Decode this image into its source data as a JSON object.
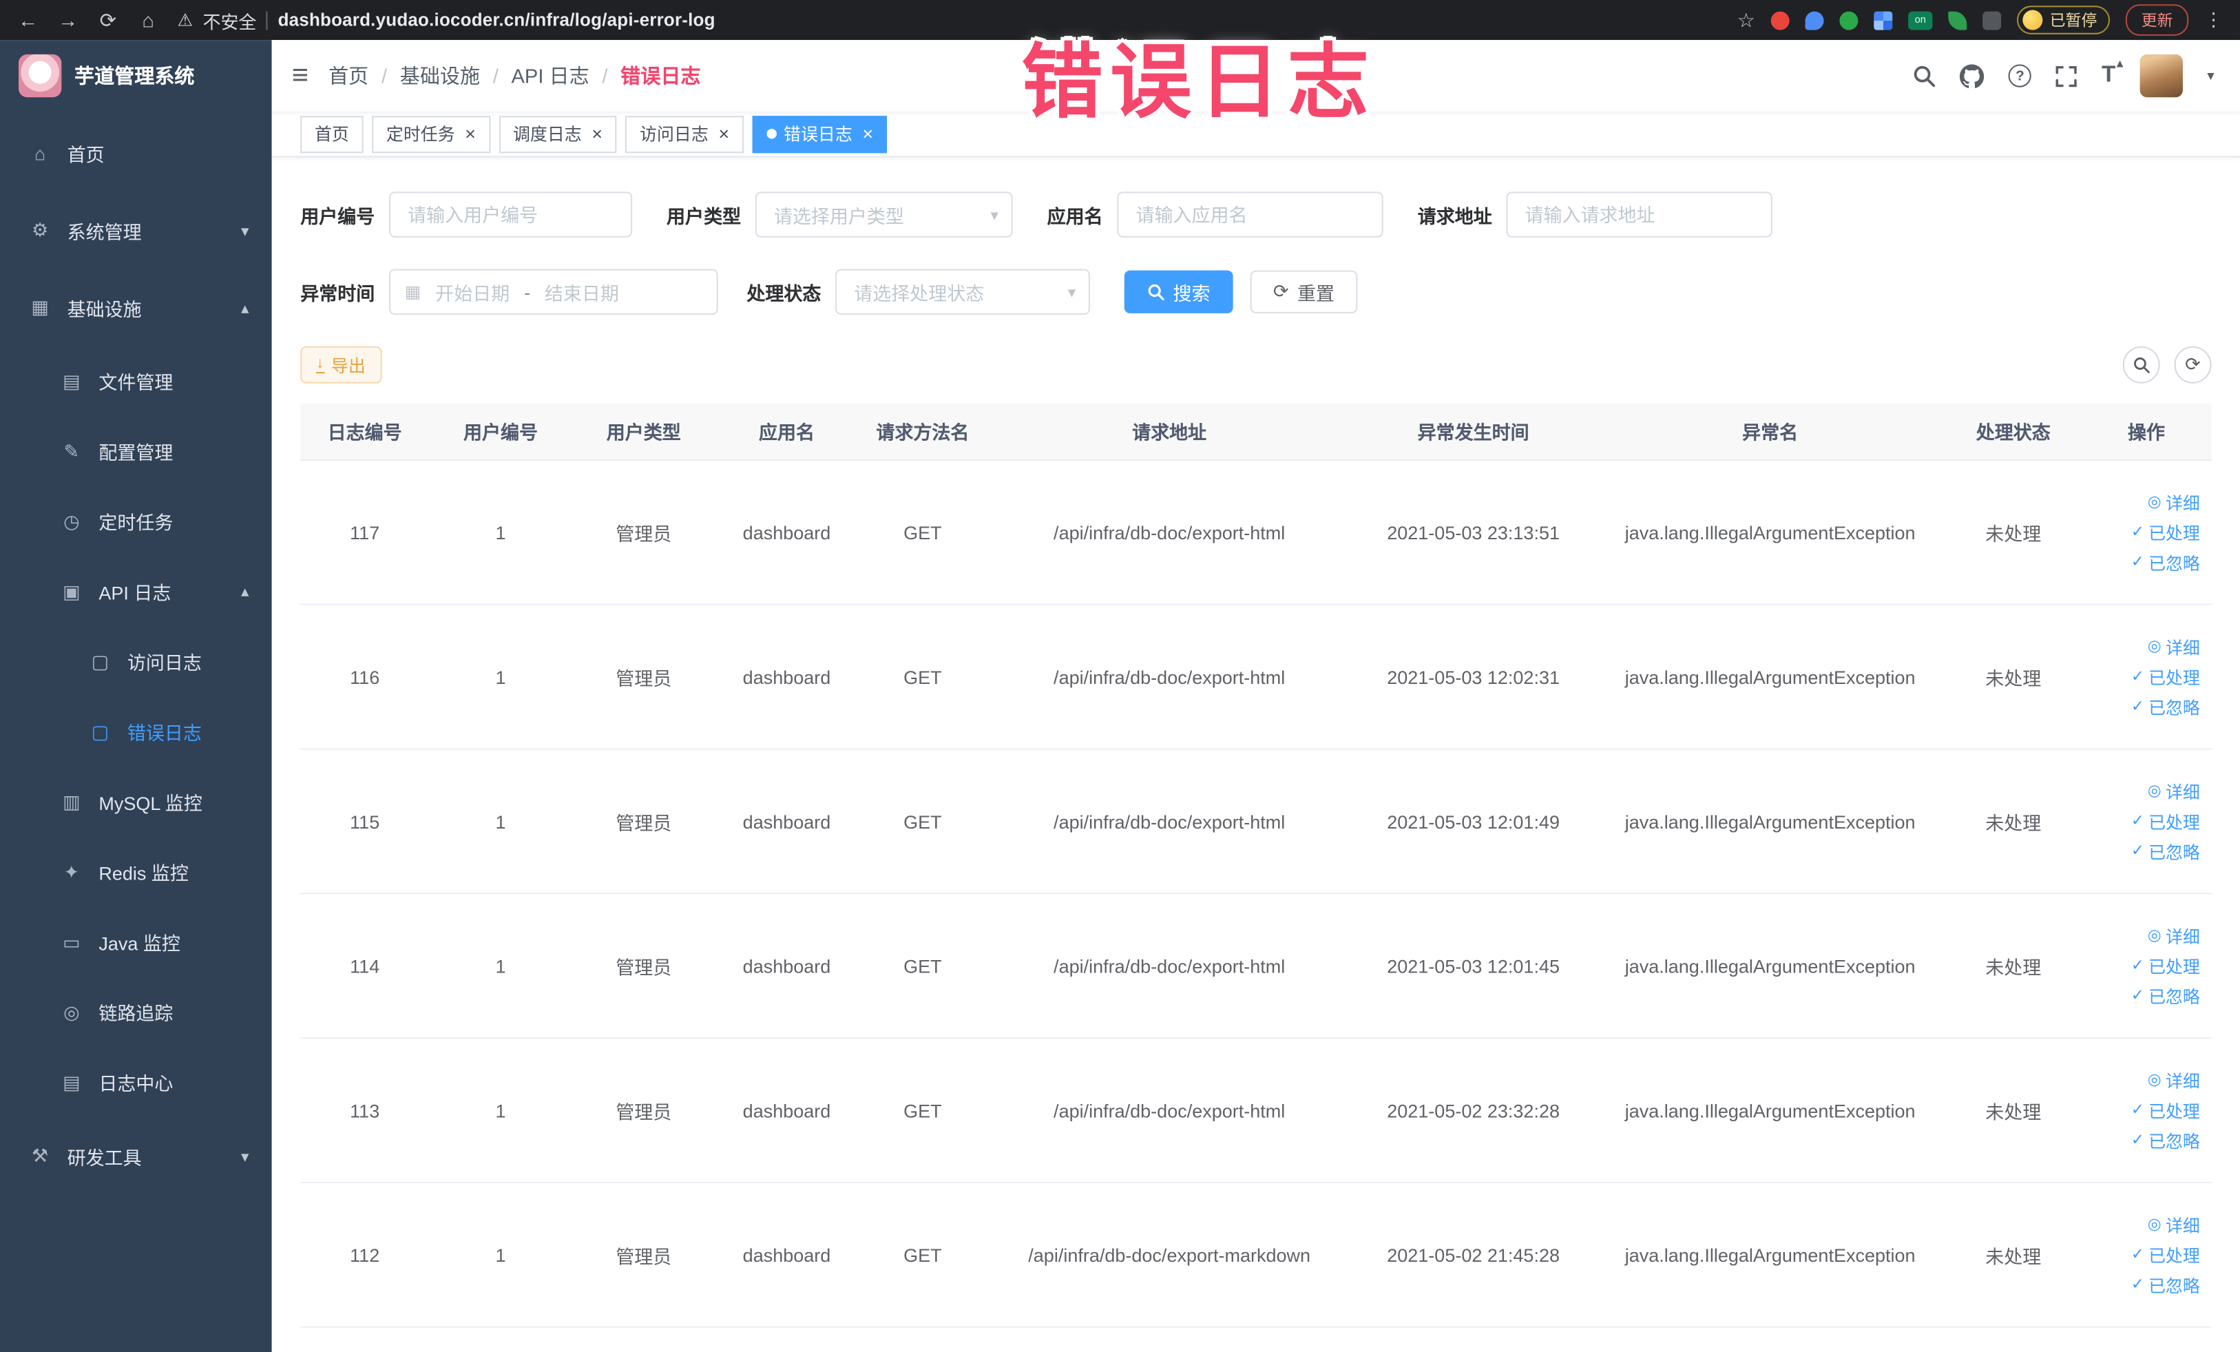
{
  "browser": {
    "security_label": "不安全",
    "url": "dashboard.yudao.iocoder.cn/infra/log/api-error-log",
    "on_badge": "on",
    "paused_badge": "已暂停",
    "update_button": "更新"
  },
  "annotation": {
    "text": "错误日志"
  },
  "sidebar": {
    "logo_title": "芋道管理系统",
    "items": [
      {
        "key": "home",
        "label": "首页",
        "icon": "home",
        "depth": 0
      },
      {
        "key": "system",
        "label": "系统管理",
        "icon": "gear",
        "depth": 0,
        "arrow": "down"
      },
      {
        "key": "infra",
        "label": "基础设施",
        "icon": "infra",
        "depth": 0,
        "arrow": "up"
      },
      {
        "key": "file",
        "label": "文件管理",
        "icon": "file",
        "depth": 1
      },
      {
        "key": "config",
        "label": "配置管理",
        "icon": "config",
        "depth": 1
      },
      {
        "key": "cron",
        "label": "定时任务",
        "icon": "clock",
        "depth": 1
      },
      {
        "key": "api-log",
        "label": "API 日志",
        "icon": "api-log",
        "depth": 1,
        "arrow": "up"
      },
      {
        "key": "access-log",
        "label": "访问日志",
        "icon": "doc",
        "depth": 2
      },
      {
        "key": "error-log",
        "label": "错误日志",
        "icon": "doc",
        "depth": 2,
        "active": true
      },
      {
        "key": "mysql",
        "label": "MySQL 监控",
        "icon": "mysql",
        "depth": 1
      },
      {
        "key": "redis",
        "label": "Redis 监控",
        "icon": "redis",
        "depth": 1
      },
      {
        "key": "java",
        "label": "Java 监控",
        "icon": "java",
        "depth": 1
      },
      {
        "key": "trace",
        "label": "链路追踪",
        "icon": "trace",
        "depth": 1
      },
      {
        "key": "log-center",
        "label": "日志中心",
        "icon": "log-center",
        "depth": 1
      },
      {
        "key": "dev-tools",
        "label": "研发工具",
        "icon": "tools",
        "depth": 0,
        "arrow": "down"
      }
    ]
  },
  "header": {
    "breadcrumb": [
      "首页",
      "基础设施",
      "API 日志",
      "错误日志"
    ]
  },
  "tabs": [
    {
      "key": "home",
      "label": "首页",
      "closable": false
    },
    {
      "key": "cron-task",
      "label": "定时任务",
      "closable": true
    },
    {
      "key": "schedule-log",
      "label": "调度日志",
      "closable": true
    },
    {
      "key": "access-log",
      "label": "访问日志",
      "closable": true
    },
    {
      "key": "error-log",
      "label": "错误日志",
      "closable": true,
      "active": true
    }
  ],
  "filters": {
    "user_id": {
      "label": "用户编号",
      "placeholder": "请输入用户编号"
    },
    "user_type": {
      "label": "用户类型",
      "placeholder": "请选择用户类型"
    },
    "app_name": {
      "label": "应用名",
      "placeholder": "请输入应用名"
    },
    "request_url": {
      "label": "请求地址",
      "placeholder": "请输入请求地址"
    },
    "exception_time": {
      "label": "异常时间",
      "start_placeholder": "开始日期",
      "separator": "-",
      "end_placeholder": "结束日期"
    },
    "process_status": {
      "label": "处理状态",
      "placeholder": "请选择处理状态"
    },
    "search_label": "搜索",
    "reset_label": "重置"
  },
  "toolbar": {
    "export_label": "导出"
  },
  "table": {
    "columns": [
      "日志编号",
      "用户编号",
      "用户类型",
      "应用名",
      "请求方法名",
      "请求地址",
      "异常发生时间",
      "异常名",
      "处理状态",
      "操作"
    ],
    "row_actions": [
      {
        "key": "detail",
        "label": "详细",
        "icon": "eye"
      },
      {
        "key": "processed",
        "label": "已处理",
        "icon": "check"
      },
      {
        "key": "ignored",
        "label": "已忽略",
        "icon": "check"
      }
    ],
    "rows": [
      {
        "cells": [
          "117",
          "1",
          "管理员",
          "dashboard",
          "GET",
          "/api/infra/db-doc/export-html",
          "2021-05-03 23:13:51",
          "java.lang.IllegalArgumentException",
          "未处理"
        ]
      },
      {
        "cells": [
          "116",
          "1",
          "管理员",
          "dashboard",
          "GET",
          "/api/infra/db-doc/export-html",
          "2021-05-03 12:02:31",
          "java.lang.IllegalArgumentException",
          "未处理"
        ]
      },
      {
        "cells": [
          "115",
          "1",
          "管理员",
          "dashboard",
          "GET",
          "/api/infra/db-doc/export-html",
          "2021-05-03 12:01:49",
          "java.lang.IllegalArgumentException",
          "未处理"
        ]
      },
      {
        "cells": [
          "114",
          "1",
          "管理员",
          "dashboard",
          "GET",
          "/api/infra/db-doc/export-html",
          "2021-05-03 12:01:45",
          "java.lang.IllegalArgumentException",
          "未处理"
        ]
      },
      {
        "cells": [
          "113",
          "1",
          "管理员",
          "dashboard",
          "GET",
          "/api/infra/db-doc/export-html",
          "2021-05-02 23:32:28",
          "java.lang.IllegalArgumentException",
          "未处理"
        ]
      },
      {
        "cells": [
          "112",
          "1",
          "管理员",
          "dashboard",
          "GET",
          "/api/infra/db-doc/export-markdown",
          "2021-05-02 21:45:28",
          "java.lang.IllegalArgumentException",
          "未处理"
        ]
      }
    ]
  },
  "colors": {
    "primary": "#409EFF",
    "warning": "#E6A23C",
    "sidebar_bg": "#304156",
    "chrome_bg": "#202124",
    "annotation_pink": "#F4476B"
  },
  "icons": {
    "back": "←",
    "forward": "→",
    "reload": "⟳",
    "home": "⌂",
    "warning": "⚠",
    "star": "☆",
    "kebab": "⋮",
    "hamburger": "≡",
    "chevron-down": "▾",
    "chevron-up": "▴",
    "caret-down": "▾",
    "gear": "⚙",
    "infra": "▦",
    "file": "▤",
    "config": "✎",
    "clock": "◷",
    "api-log": "▣",
    "doc": "▢",
    "mysql": "▥",
    "redis": "✦",
    "java": "▭",
    "trace": "◎",
    "log-center": "▤",
    "tools": "⚒",
    "eye": "◎",
    "check": "✓",
    "download": "↓",
    "refresh": "⟳",
    "calendar": "▦",
    "close": "×",
    "question": "?",
    "font-size": "T"
  }
}
